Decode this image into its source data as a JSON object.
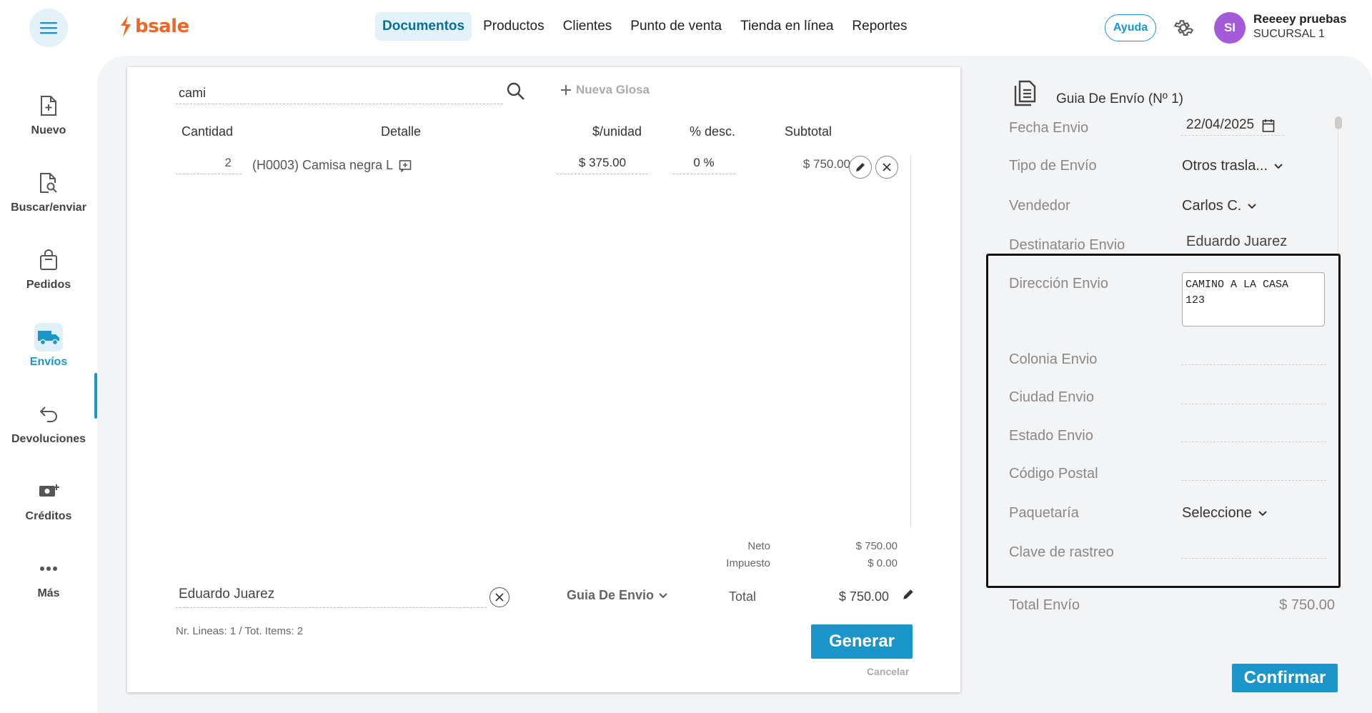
{
  "header": {
    "logo_text": "bsale",
    "nav": [
      "Documentos",
      "Productos",
      "Clientes",
      "Punto de venta",
      "Tienda en línea",
      "Reportes"
    ],
    "help_label": "Ayuda",
    "avatar_initials": "SI",
    "user_name": "Reeeey pruebas",
    "user_branch": "SUCURSAL 1",
    "accent_color": "#1a96c8",
    "brand_color": "#f26522"
  },
  "sidebar": {
    "items": [
      {
        "label": "Nuevo",
        "icon": "file-plus-icon"
      },
      {
        "label": "Buscar/enviar",
        "icon": "file-search-icon"
      },
      {
        "label": "Pedidos",
        "icon": "shopping-bag-icon"
      },
      {
        "label": "Envíos",
        "icon": "truck-icon"
      },
      {
        "label": "Devoluciones",
        "icon": "return-arrow-icon"
      },
      {
        "label": "Créditos",
        "icon": "cash-plus-icon"
      },
      {
        "label": "Más",
        "icon": "more-dots-icon"
      }
    ],
    "active": "Envíos"
  },
  "document": {
    "search_value": "cami",
    "new_gloss_label": "Nueva Glosa",
    "columns": [
      "Cantidad",
      "Detalle",
      "$/unidad",
      "% desc.",
      "Subtotal"
    ],
    "rows": [
      {
        "qty": "2",
        "detail": "(H0003) Camisa negra L",
        "unit_price": "$ 375.00",
        "discount": "0 %",
        "subtotal": "$ 750.00"
      }
    ],
    "neto_label": "Neto",
    "neto_value": "$ 750.00",
    "tax_label": "Impuesto",
    "tax_value": "$ 0.00",
    "client_value": "Eduardo Juarez",
    "doc_type": "Guia De Envio",
    "total_label": "Total",
    "total_value": "$ 750.00",
    "lines_info": "Nr. Lineas: 1 / Tot. Items: 2",
    "generate_label": "Generar",
    "cancel_label": "Cancelar"
  },
  "shipping": {
    "title": "Guia De Envío (Nº 1)",
    "fecha_label": "Fecha Envio",
    "fecha_value": "22/04/2025",
    "tipo_label": "Tipo de Envío",
    "tipo_value": "Otros trasla...",
    "vendedor_label": "Vendedor",
    "vendedor_value": "Carlos C.",
    "destinatario_label": "Destinatario Envio",
    "destinatario_value": "Eduardo Juarez",
    "direccion_label": "Dirección Envio",
    "direccion_value": "CAMINO A LA CASA\n123",
    "colonia_label": "Colonia Envio",
    "ciudad_label": "Ciudad Envio",
    "estado_label": "Estado Envio",
    "cp_label": "Código Postal",
    "paqueteria_label": "Paquetaría",
    "paqueteria_value": "Seleccione",
    "rastreo_label": "Clave de rastreo",
    "total_envio_label": "Total Envío",
    "total_envio_value": "$ 750.00",
    "confirm_label": "Confirmar"
  }
}
